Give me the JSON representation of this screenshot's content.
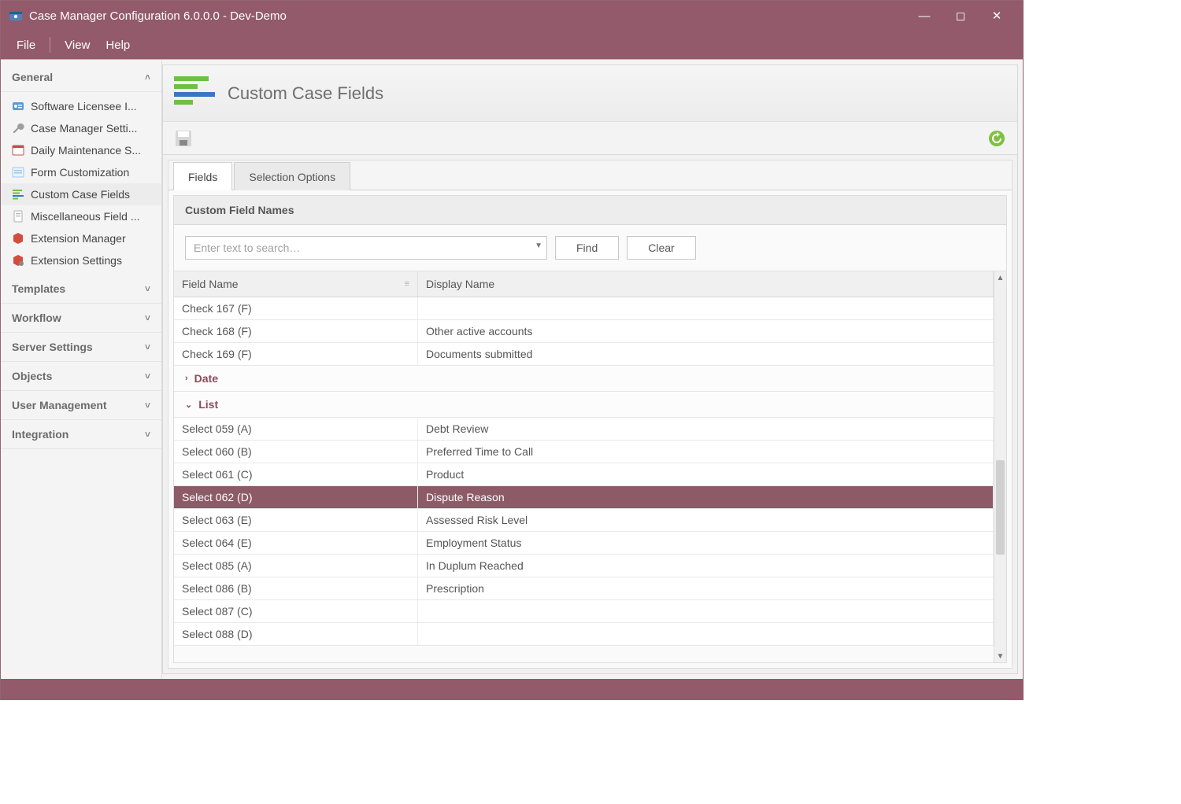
{
  "window": {
    "title": "Case Manager Configuration 6.0.0.0 - Dev-Demo"
  },
  "menubar": {
    "items": [
      "File",
      "View",
      "Help"
    ]
  },
  "sidebar": {
    "open_section": "General",
    "sections": [
      {
        "label": "General",
        "expanded": true,
        "items": [
          {
            "label": "Software Licensee I..."
          },
          {
            "label": "Case Manager Setti..."
          },
          {
            "label": "Daily Maintenance S..."
          },
          {
            "label": "Form Customization"
          },
          {
            "label": "Custom Case Fields",
            "selected": true
          },
          {
            "label": "Miscellaneous Field ..."
          },
          {
            "label": "Extension Manager"
          },
          {
            "label": "Extension Settings"
          }
        ]
      },
      {
        "label": "Templates",
        "expanded": false
      },
      {
        "label": "Workflow",
        "expanded": false
      },
      {
        "label": "Server Settings",
        "expanded": false
      },
      {
        "label": "Objects",
        "expanded": false
      },
      {
        "label": "User Management",
        "expanded": false
      },
      {
        "label": "Integration",
        "expanded": false
      }
    ]
  },
  "page": {
    "title": "Custom Case Fields"
  },
  "tabs": {
    "items": [
      "Fields",
      "Selection Options"
    ],
    "active": "Fields"
  },
  "panel": {
    "title": "Custom Field Names"
  },
  "search": {
    "placeholder": "Enter text to search…",
    "find": "Find",
    "clear": "Clear"
  },
  "grid": {
    "columns": {
      "field_name": "Field Name",
      "display_name": "Display Name"
    },
    "check_rows": [
      {
        "field": "Check 167 (F)",
        "display": ""
      },
      {
        "field": "Check 168 (F)",
        "display": "Other active accounts"
      },
      {
        "field": "Check 169 (F)",
        "display": "Documents submitted"
      }
    ],
    "groups": [
      {
        "name": "Date",
        "expanded": false
      },
      {
        "name": "List",
        "expanded": true
      }
    ],
    "list_rows": [
      {
        "field": "Select 059 (A)",
        "display": "Debt Review"
      },
      {
        "field": "Select 060 (B)",
        "display": "Preferred Time to Call"
      },
      {
        "field": "Select 061 (C)",
        "display": "Product"
      },
      {
        "field": "Select 062 (D)",
        "display": "Dispute Reason",
        "selected": true
      },
      {
        "field": "Select 063 (E)",
        "display": "Assessed Risk Level"
      },
      {
        "field": "Select 064 (E)",
        "display": "Employment Status"
      },
      {
        "field": "Select 085 (A)",
        "display": "In Duplum Reached"
      },
      {
        "field": "Select 086 (B)",
        "display": "Prescription"
      },
      {
        "field": "Select 087 (C)",
        "display": ""
      },
      {
        "field": "Select 088 (D)",
        "display": ""
      }
    ]
  }
}
